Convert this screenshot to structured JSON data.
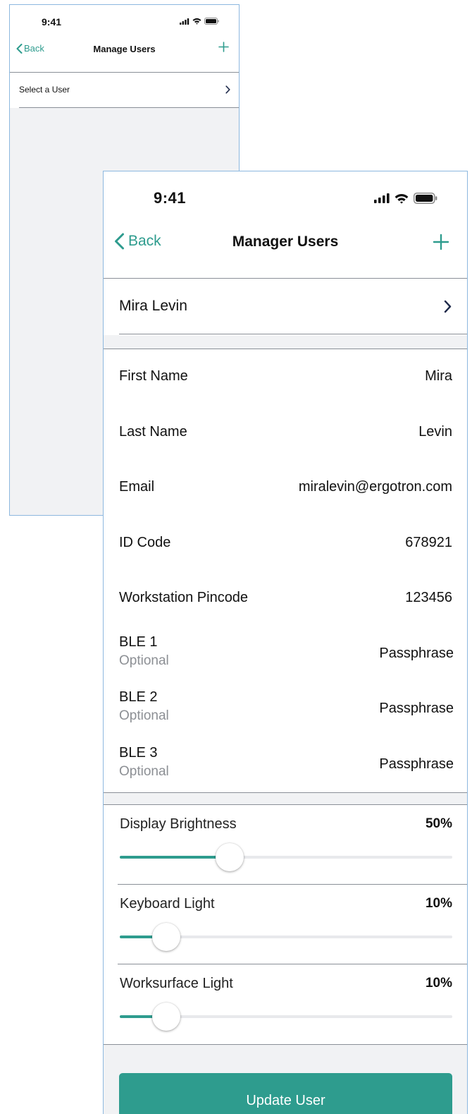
{
  "back_screen": {
    "status": {
      "time": "9:41"
    },
    "nav": {
      "back_label": "Back",
      "title": "Manage Users"
    },
    "select_row": {
      "label": "Select a User"
    }
  },
  "front_screen": {
    "status": {
      "time": "9:41"
    },
    "nav": {
      "back_label": "Back",
      "title": "Manager Users"
    },
    "selected_user": "Mira Levin",
    "fields": [
      {
        "label": "First Name",
        "value": "Mira"
      },
      {
        "label": "Last Name",
        "value": "Levin"
      },
      {
        "label": "Email",
        "value": "miralevin@ergotron.com"
      },
      {
        "label": "ID Code",
        "value": "678921"
      },
      {
        "label": "Workstation Pincode",
        "value": "123456"
      }
    ],
    "ble": [
      {
        "label": "BLE 1",
        "sublabel": "Optional",
        "value": "Passphrase"
      },
      {
        "label": "BLE 2",
        "sublabel": "Optional",
        "value": "Passphrase"
      },
      {
        "label": "BLE 3",
        "sublabel": "Optional",
        "value": "Passphrase"
      }
    ],
    "sliders": [
      {
        "label": "Display Brightness",
        "value_text": "50%",
        "fraction": 0.33
      },
      {
        "label": "Keyboard Light",
        "value_text": "10%",
        "fraction": 0.14
      },
      {
        "label": "Worksurface Light",
        "value_text": "10%",
        "fraction": 0.14
      }
    ],
    "update_button_label": "Update User"
  },
  "colors": {
    "accent": "#2e9c8e",
    "divider": "#8a8f97",
    "background": "#f1f2f4",
    "secondary_text": "#8c8f94"
  },
  "icons": [
    "signal-icon",
    "wifi-icon",
    "battery-icon",
    "chevron-left-icon",
    "plus-icon",
    "chevron-right-icon"
  ]
}
